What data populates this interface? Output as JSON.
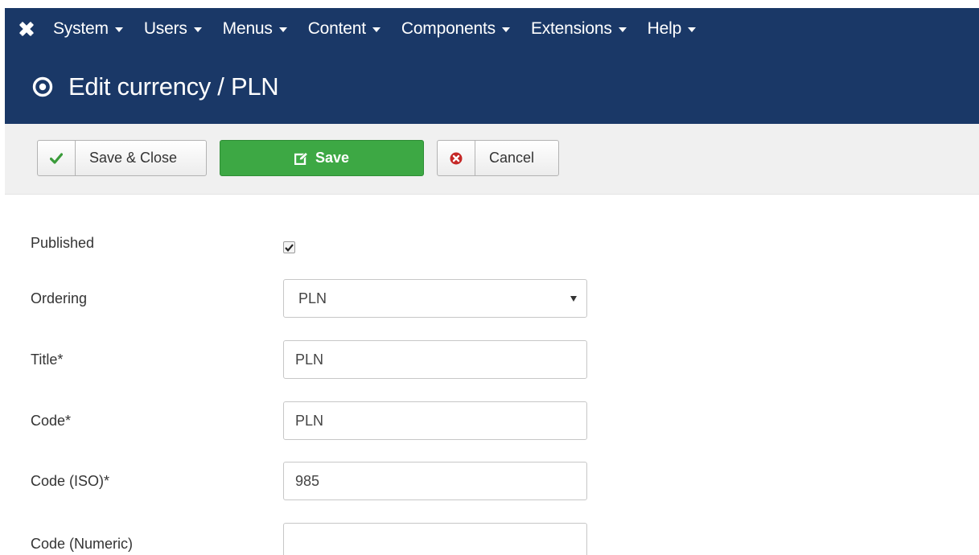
{
  "nav": {
    "items": [
      {
        "label": "System"
      },
      {
        "label": "Users"
      },
      {
        "label": "Menus"
      },
      {
        "label": "Content"
      },
      {
        "label": "Components"
      },
      {
        "label": "Extensions"
      },
      {
        "label": "Help"
      }
    ]
  },
  "header": {
    "title": "Edit currency / PLN",
    "icon": "target-circle-icon"
  },
  "toolbar": {
    "save_close_label": "Save & Close",
    "save_label": "Save",
    "cancel_label": "Cancel"
  },
  "form": {
    "published": {
      "label": "Published",
      "checked": true
    },
    "ordering": {
      "label": "Ordering",
      "value": "PLN"
    },
    "title": {
      "label": "Title*",
      "value": "PLN"
    },
    "code": {
      "label": "Code*",
      "value": "PLN"
    },
    "code_iso": {
      "label": "Code (ISO)*",
      "value": "985"
    },
    "code_numeric": {
      "label": "Code (Numeric)",
      "value": ""
    }
  },
  "colors": {
    "header_bg": "#1a3867",
    "save_green": "#3da844",
    "cancel_red": "#c52827",
    "check_green": "#3a9b3a"
  }
}
